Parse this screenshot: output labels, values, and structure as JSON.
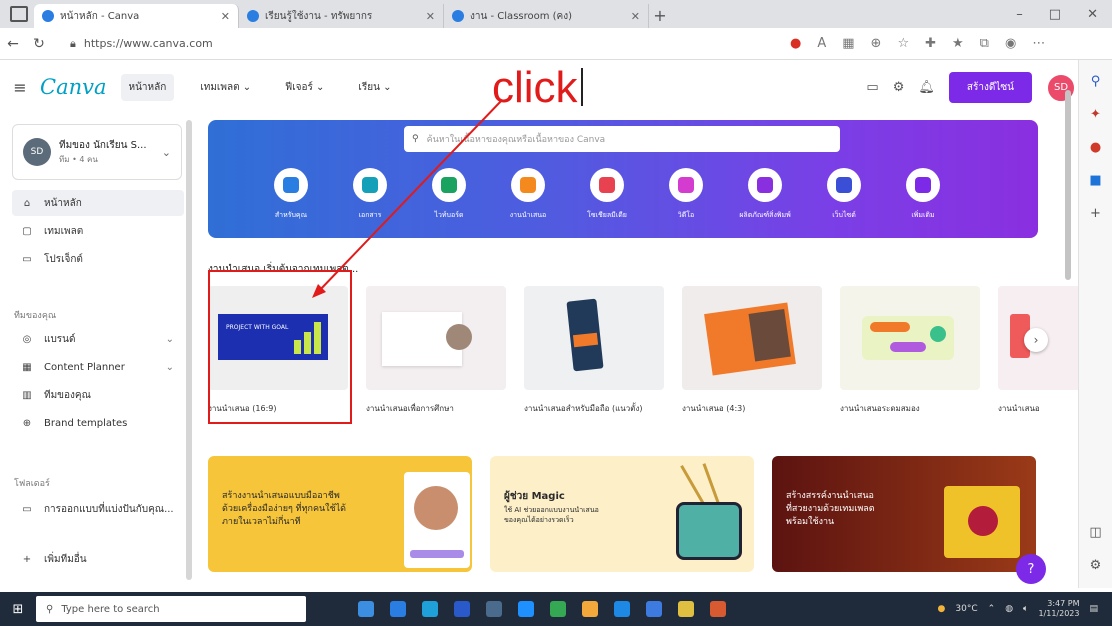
{
  "browser": {
    "tabs": [
      {
        "title": "หน้าหลัก - Canva",
        "active": true
      },
      {
        "title": "เรียนรู้ใช้งาน - ทรัพยากร",
        "active": false
      },
      {
        "title": "งาน - Classroom (คง)",
        "active": false
      }
    ],
    "new_tab": "+",
    "url": "https://www.canva.com",
    "controls": {
      "minimize": "–",
      "maximize": "□",
      "close": "✕"
    }
  },
  "header": {
    "logo": "Canva",
    "nav": [
      {
        "label": "หน้าหลัก",
        "active": true
      },
      {
        "label": "เทมเพลต ⌄",
        "active": false
      },
      {
        "label": "ฟีเจอร์ ⌄",
        "active": false
      },
      {
        "label": "เรียน ⌄",
        "active": false
      }
    ],
    "create_label": "สร้างดีไซน์",
    "avatar_initials": "SD"
  },
  "annotation": {
    "text": "click"
  },
  "sidebar": {
    "team_initials": "SD",
    "team_name": "ทีมของ นักเรียน S...",
    "team_sub": "ทีม • 4 คน",
    "items_top": [
      {
        "icon": "⌂",
        "label": "หน้าหลัก",
        "active": true
      },
      {
        "icon": "▢",
        "label": "เทมเพลต"
      },
      {
        "icon": "▭",
        "label": "โปรเจ็กต์"
      }
    ],
    "section_label": "ทีมของคุณ",
    "items_team": [
      {
        "icon": "◎",
        "label": "แบรนด์",
        "chev": "⌄"
      },
      {
        "icon": "▦",
        "label": "Content Planner",
        "chev": "⌄"
      },
      {
        "icon": "▥",
        "label": "ทีมของคุณ"
      },
      {
        "icon": "⊕",
        "label": "Brand templates"
      }
    ],
    "folders_label": "โฟลเดอร์",
    "folder": {
      "icon": "▭",
      "label": "การออกแบบที่แบ่งปันกับคุณ..."
    },
    "add_label": "เพิ่มทีมอื่น"
  },
  "hero": {
    "search_placeholder": "ค้นหาในเนื้อหาของคุณหรือเนื้อหาของ Canva",
    "categories": [
      {
        "label": "สำหรับคุณ",
        "color": "#2a7de1"
      },
      {
        "label": "เอกสาร",
        "color": "#14a0b8"
      },
      {
        "label": "ไวท์บอร์ด",
        "color": "#1aa260"
      },
      {
        "label": "งานนำเสนอ",
        "color": "#f48a1d"
      },
      {
        "label": "โซเชียลมีเดีย",
        "color": "#e8414f"
      },
      {
        "label": "วิดีโอ",
        "color": "#d43ccf"
      },
      {
        "label": "ผลิตภัณฑ์สิ่งพิมพ์",
        "color": "#8a2fe0"
      },
      {
        "label": "เว็บไซต์",
        "color": "#3a4fd6"
      },
      {
        "label": "เพิ่มเติม",
        "color": "#7d2ae8"
      }
    ]
  },
  "section_title": "งานนำเสนอ เริ่มต้นจากเทมเพลต...",
  "cards": [
    {
      "label": "งานนำเสนอ (16:9)",
      "thumb_text": "PROJECT WITH GOAL"
    },
    {
      "label": "งานนำเสนอเพื่อการศึกษา"
    },
    {
      "label": "งานนำเสนอสำหรับมือถือ (แนวตั้ง)"
    },
    {
      "label": "งานนำเสนอ (4:3)"
    },
    {
      "label": "งานนำเสนอระดมสมอง"
    },
    {
      "label": "งานนำเสนอ"
    }
  ],
  "next_arrow": "›",
  "banners": [
    {
      "line1": "สร้างงานนำเสนอแบบมืออาชีพ",
      "line2": "ด้วยเครื่องมือง่ายๆ ที่ทุกคนใช้ได้",
      "line3": "ภายในเวลาไม่กี่นาที"
    },
    {
      "line1": "ผู้ช่วย Magic",
      "line2": "ใช้ AI ช่วยออกแบบงานนำเสนอ",
      "line3": "ของคุณได้อย่างรวดเร็ว"
    },
    {
      "line1": "สร้างสรรค์งานนำเสนอ",
      "line2": "ที่สวยงามด้วยเทมเพลต",
      "line3": "พร้อมใช้งาน"
    }
  ],
  "help": "?",
  "taskbar": {
    "search_placeholder": "Type here to search",
    "apps": [
      "#3c8ee0",
      "#2a7de1",
      "#1fa0d8",
      "#2a59c9",
      "#4a6b8c",
      "#1e90ff",
      "#34a853",
      "#f2a83a",
      "#1e88e5",
      "#3d7be0",
      "#e0c040",
      "#d85a30"
    ],
    "weather": "30°C",
    "time": "3:47 PM",
    "date": "1/11/2023"
  }
}
